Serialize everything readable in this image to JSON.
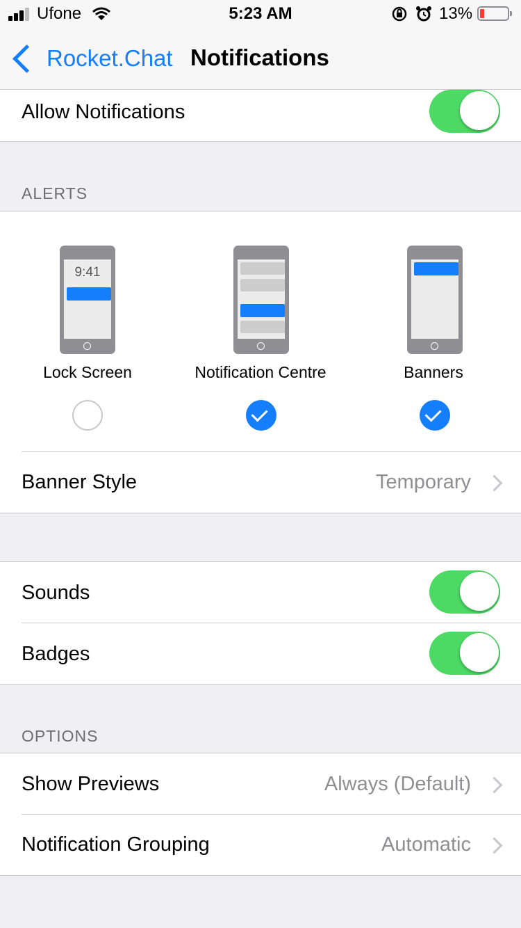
{
  "status_bar": {
    "carrier": "Ufone",
    "time": "5:23 AM",
    "battery_percent": "13%",
    "battery_level": 0.13,
    "signal_bars_filled": 3
  },
  "nav": {
    "back_label": "Rocket.Chat",
    "title": "Notifications"
  },
  "allow": {
    "label": "Allow Notifications",
    "on": true
  },
  "alerts": {
    "header": "ALERTS",
    "items": [
      {
        "label": "Lock Screen",
        "time": "9:41",
        "selected": false
      },
      {
        "label": "Notification Centre",
        "selected": true
      },
      {
        "label": "Banners",
        "selected": true
      }
    ],
    "banner_style": {
      "label": "Banner Style",
      "value": "Temporary"
    }
  },
  "sounds": {
    "label": "Sounds",
    "on": true
  },
  "badges": {
    "label": "Badges",
    "on": true
  },
  "options": {
    "header": "OPTIONS",
    "show_previews": {
      "label": "Show Previews",
      "value": "Always (Default)"
    },
    "grouping": {
      "label": "Notification Grouping",
      "value": "Automatic"
    }
  },
  "colors": {
    "accent": "#157efb",
    "toggle_on": "#4cd964",
    "battery_low": "#ff3b30"
  }
}
